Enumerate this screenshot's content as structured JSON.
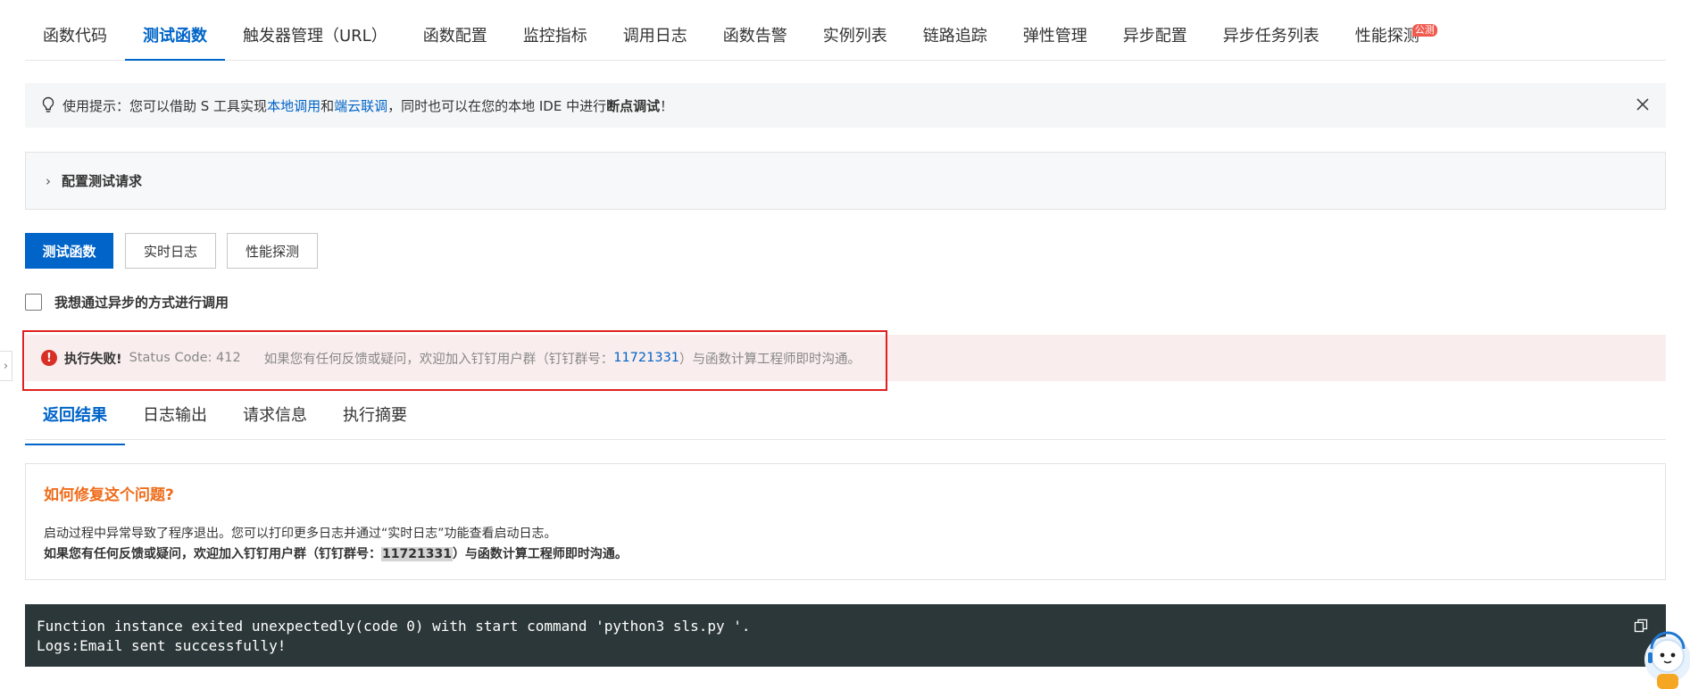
{
  "top_tabs": [
    {
      "label": "函数代码"
    },
    {
      "label": "测试函数",
      "active": true
    },
    {
      "label": "触发器管理（URL）"
    },
    {
      "label": "函数配置"
    },
    {
      "label": "监控指标"
    },
    {
      "label": "调用日志"
    },
    {
      "label": "函数告警"
    },
    {
      "label": "实例列表"
    },
    {
      "label": "链路追踪"
    },
    {
      "label": "弹性管理"
    },
    {
      "label": "异步配置"
    },
    {
      "label": "异步任务列表"
    },
    {
      "label": "性能探测",
      "badge": "公测"
    }
  ],
  "tip": {
    "prefix": "使用提示：您可以借助 S 工具实现",
    "link1": "本地调用",
    "and": "和",
    "link2": "端云联调",
    "middle": "，同时也可以在您的本地 IDE 中进行",
    "bold": "断点调试",
    "suffix": "！",
    "icon": "lightbulb-icon"
  },
  "config_panel": {
    "label": "配置测试请求"
  },
  "buttons": {
    "test": "测试函数",
    "realtime_log": "实时日志",
    "perf_probe": "性能探测"
  },
  "async_checkbox": {
    "label": "我想通过异步的方式进行调用",
    "checked": false
  },
  "error": {
    "title": "执行失败!",
    "status": "Status Code: 412",
    "msg_prefix": "如果您有任何反馈或疑问，欢迎加入钉钉用户群（钉钉群号：",
    "group_id": "11721331",
    "msg_suffix": "）与函数计算工程师即时沟通。"
  },
  "result_tabs": [
    {
      "label": "返回结果",
      "active": true
    },
    {
      "label": "日志输出"
    },
    {
      "label": "请求信息"
    },
    {
      "label": "执行摘要"
    }
  ],
  "fix": {
    "title": "如何修复这个问题?",
    "line1": "启动过程中异常导致了程序退出。您可以打印更多日志并通过“实时日志”功能查看启动日志。",
    "line2_prefix": "如果您有任何反馈或疑问，欢迎加入钉钉用户群（钉钉群号：",
    "line2_id": "11721331",
    "line2_suffix": "）与函数计算工程师即时沟通。"
  },
  "console": {
    "line1": "Function instance exited unexpectedly(code 0) with start command 'python3 sls.py '.",
    "line2": "Logs:Email sent successfully!"
  },
  "colors": {
    "accent": "#0064c8",
    "error": "#d93026",
    "warning_title": "#ef6c1a",
    "console_bg": "#2c3739"
  }
}
